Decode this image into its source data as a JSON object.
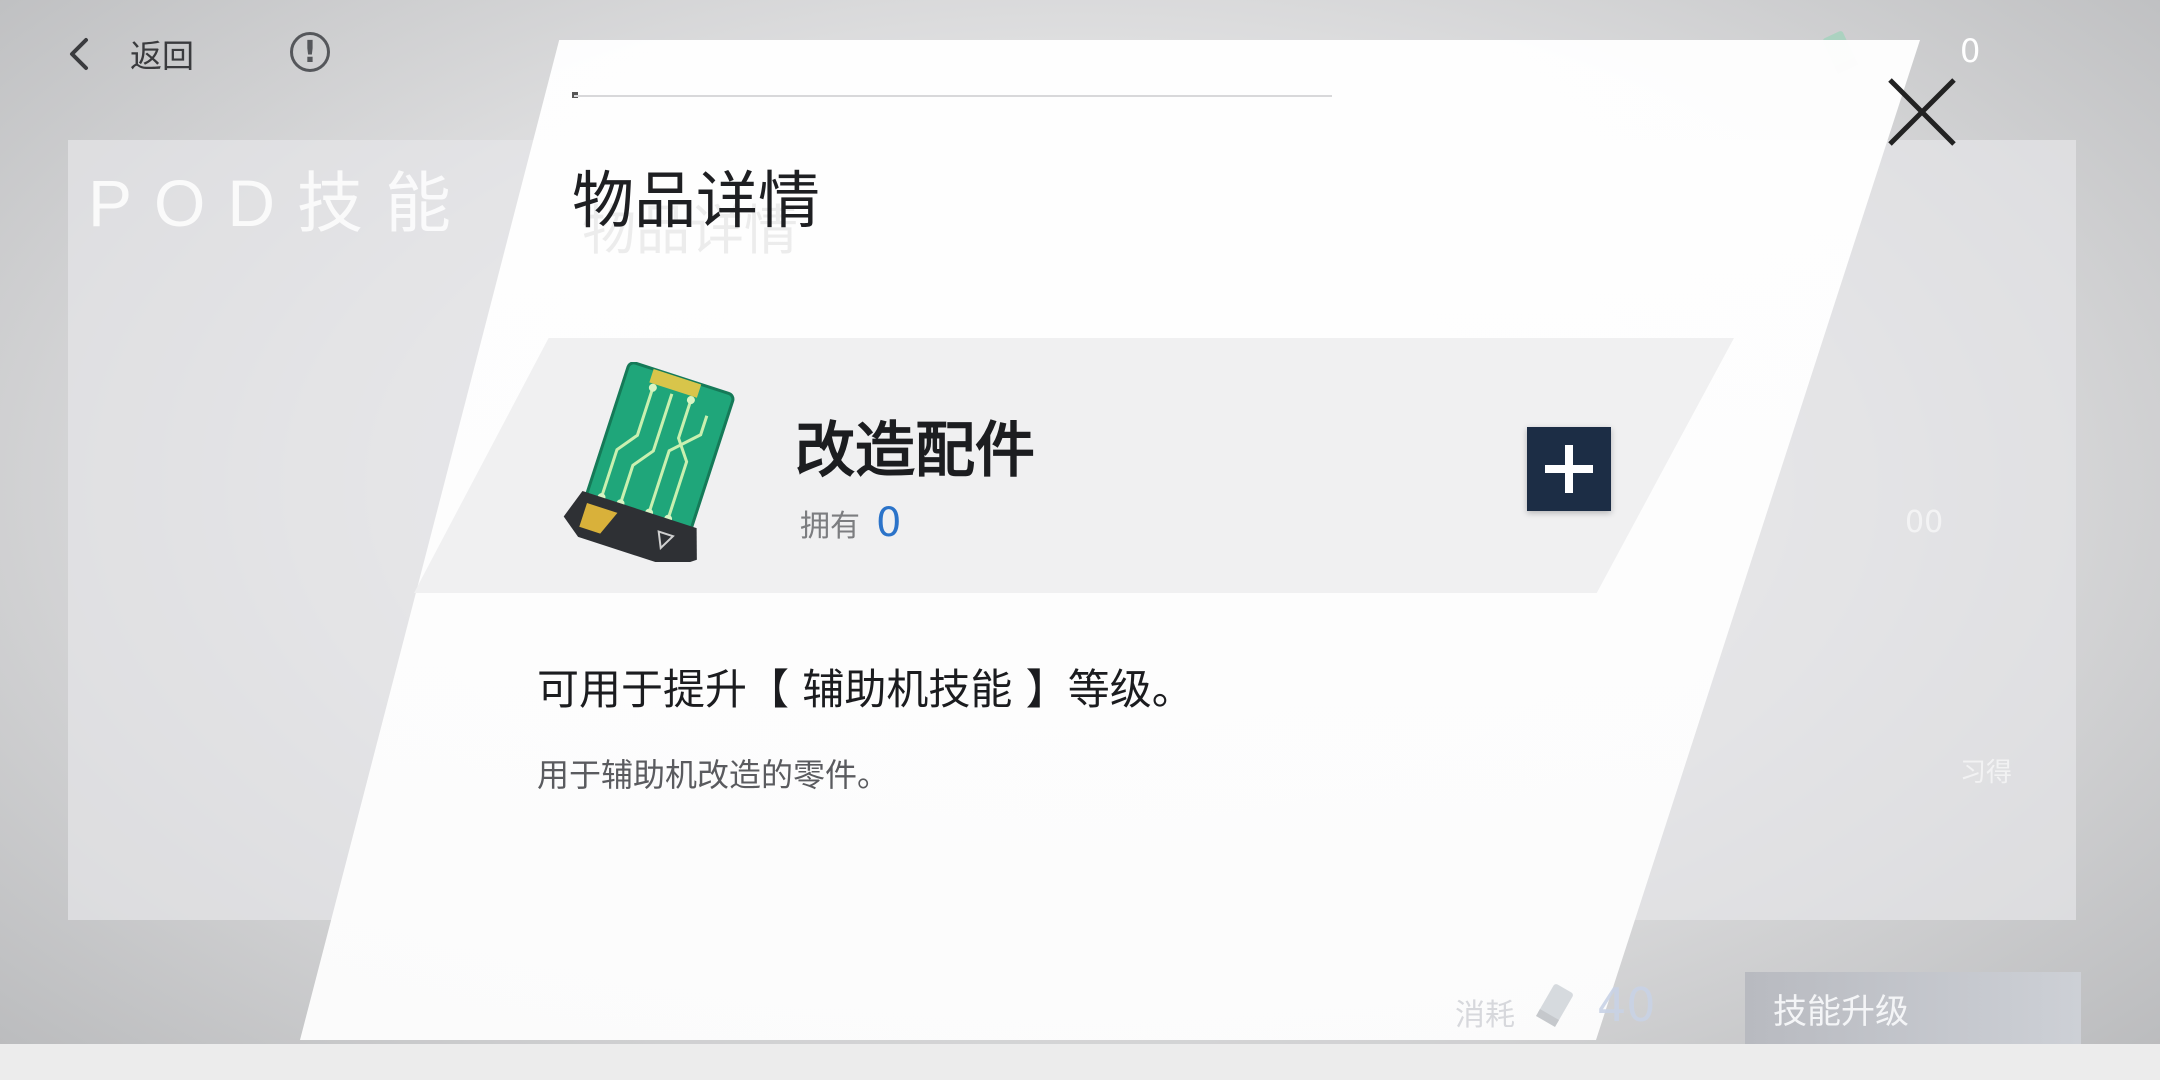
{
  "background": {
    "screen_title": "POD技能",
    "side_value": "00",
    "side_label": "习得"
  },
  "topbar": {
    "back_label": "返回",
    "info_symbol": "!",
    "currency_value": "0"
  },
  "modal": {
    "title": "物品详情",
    "title_ghost": "物品详情",
    "item": {
      "name": "改造配件",
      "own_label": "拥有",
      "own_value": "0",
      "plus_symbol": "+"
    },
    "description": "可用于提升【 辅助机技能 】等级。",
    "flavor_text": "用于辅助机改造的零件。"
  },
  "bottombar": {
    "cost_label": "消耗",
    "cost_value": "40",
    "upgrade_button_label": "技能升级"
  },
  "colors": {
    "accent_blue": "#2b73c9",
    "plus_button_bg": "#1c2d45",
    "chip_green": "#1fa67a"
  },
  "icons": {
    "back": "chevron-left-icon",
    "info": "info-icon",
    "currency": "chip-icon",
    "close": "close-icon",
    "plus": "plus-icon"
  }
}
